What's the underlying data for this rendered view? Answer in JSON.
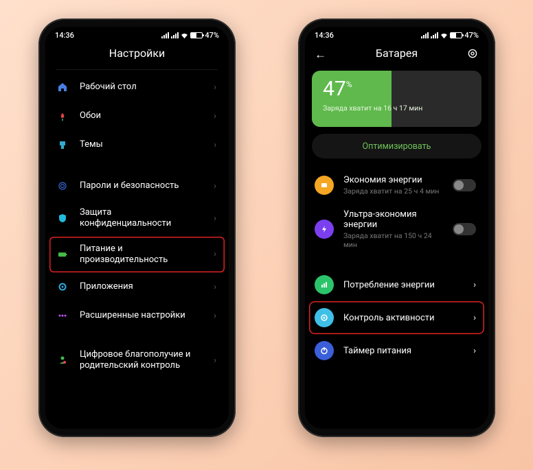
{
  "status": {
    "time": "14:36",
    "battery": "47%"
  },
  "left": {
    "title": "Настройки",
    "items": {
      "home": "Рабочий стол",
      "wallpaper": "Обои",
      "themes": "Темы",
      "security": "Пароли и безопасность",
      "privacy": "Защита конфиденциальности",
      "power": "Питание и производительность",
      "apps": "Приложения",
      "advanced": "Расширенные настройки",
      "wellbeing": "Цифровое благополучие и родительский контроль"
    }
  },
  "right": {
    "title": "Батарея",
    "pct": "47",
    "pct_sym": "%",
    "remain": "Заряда хватит на 16 ч 17 мин",
    "optimize": "Оптимизировать",
    "saver": {
      "title": "Экономия энергии",
      "sub": "Заряда хватит на 25 ч 4 мин"
    },
    "ultra": {
      "title": "Ультра-экономия энергии",
      "sub": "Заряда хватит на 150 ч 24 мин"
    },
    "consumption": "Потребление энергии",
    "activity": "Контроль активности",
    "timer": "Таймер питания"
  }
}
